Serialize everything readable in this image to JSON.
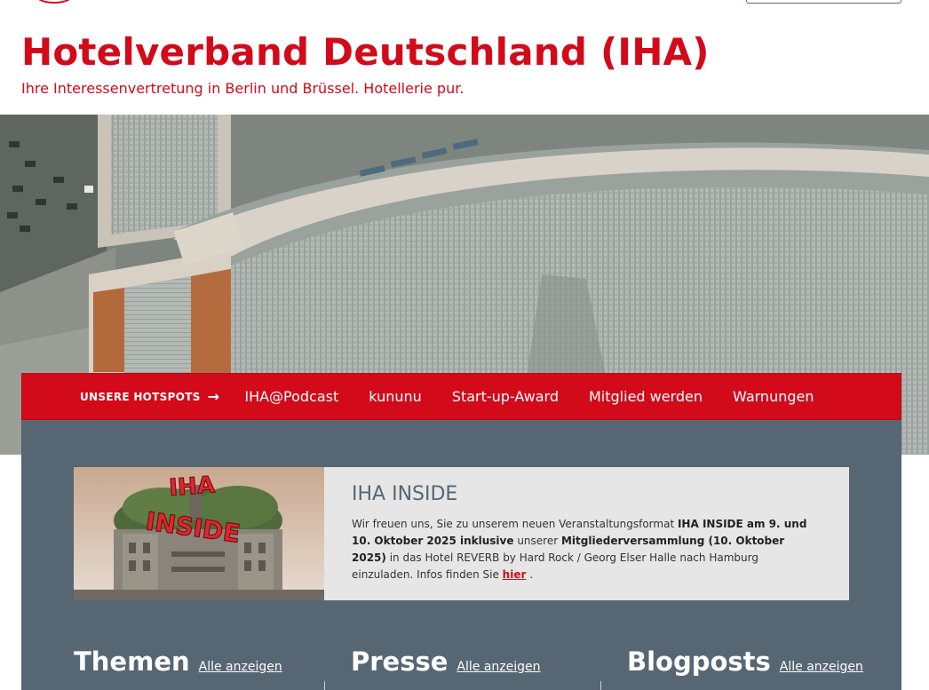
{
  "header": {
    "title": "Hotelverband Deutschland (IHA)",
    "tagline": "Ihre Interessenvertretung in Berlin und Brüssel. Hotellerie pur."
  },
  "nav": {
    "hotspots_label": "UNSERE HOTSPOTS",
    "hotspots_icon": "arrow-right-icon",
    "links": [
      "IHA@Podcast",
      "kununu",
      "Start-up-Award",
      "Mitglied werden",
      "Warnungen"
    ]
  },
  "feature": {
    "image_text": "IHA INSIDE",
    "title": "IHA INSIDE",
    "text_1": "Wir freuen uns, Sie zu unserem neuen Veranstaltungsformat ",
    "bold_1": "IHA INSIDE am 9. und 10. Oktober 2025 inklusive",
    "text_2": " unserer ",
    "bold_2": "Mitgliederversammlung (10. Oktober 2025)",
    "text_3": " in das Hotel REVERB by Hard Rock / Georg Elser Halle nach Hamburg einzuladen. Infos finden Sie ",
    "link": "hier",
    "text_4": " ."
  },
  "columns": [
    {
      "title": "Themen",
      "link": "Alle anzeigen"
    },
    {
      "title": "Presse",
      "link": "Alle anzeigen"
    },
    {
      "title": "Blogposts",
      "link": "Alle anzeigen"
    }
  ],
  "colors": {
    "brand_red": "#d20a1a",
    "panel_slate": "#576673",
    "feature_bg": "#e6e6e6"
  }
}
